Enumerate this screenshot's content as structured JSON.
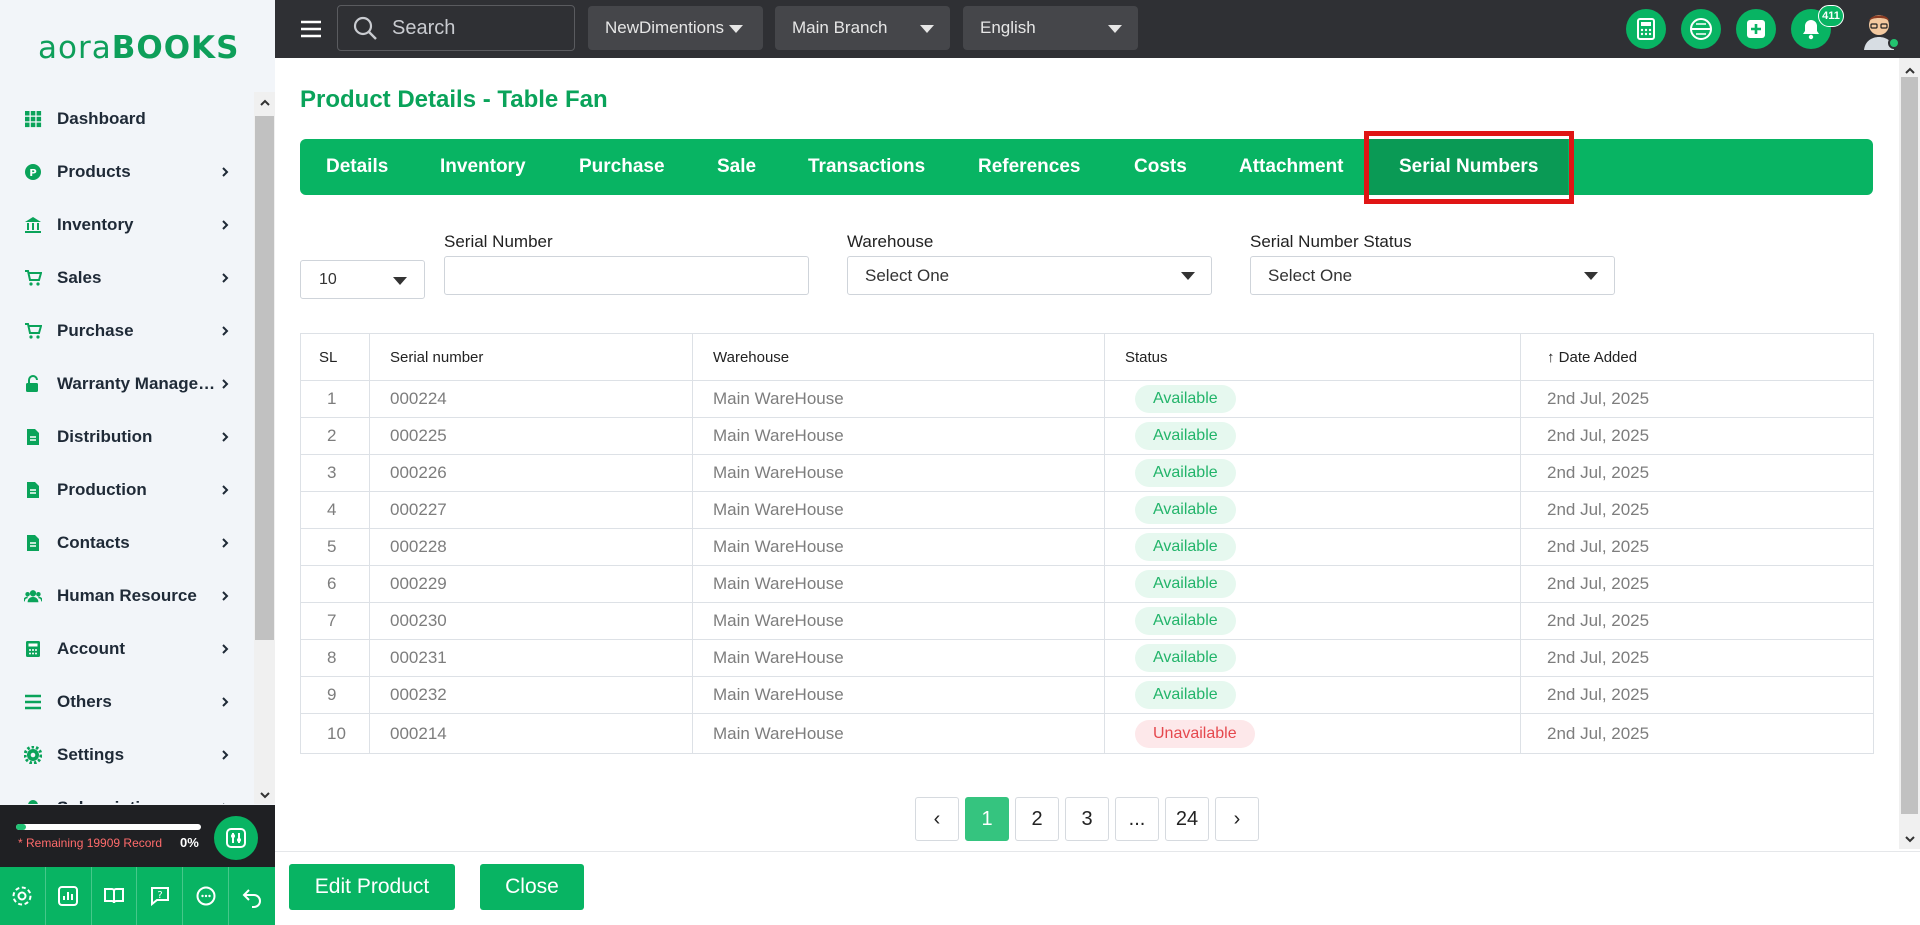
{
  "brand": {
    "logo_part1": "aora",
    "logo_part2": "BOOKS"
  },
  "sidebar": {
    "items": [
      {
        "label": "Dashboard",
        "icon": "grid-icon",
        "chevron": false
      },
      {
        "label": "Products",
        "icon": "product-icon",
        "chevron": true
      },
      {
        "label": "Inventory",
        "icon": "bank-icon",
        "chevron": true
      },
      {
        "label": "Sales",
        "icon": "cart-icon",
        "chevron": true
      },
      {
        "label": "Purchase",
        "icon": "cart-icon",
        "chevron": true
      },
      {
        "label": "Warranty Management",
        "icon": "lock-icon",
        "chevron": true
      },
      {
        "label": "Distribution",
        "icon": "file-icon",
        "chevron": true
      },
      {
        "label": "Production",
        "icon": "file-icon",
        "chevron": true
      },
      {
        "label": "Contacts",
        "icon": "file-icon",
        "chevron": true
      },
      {
        "label": "Human Resource",
        "icon": "users-icon",
        "chevron": true
      },
      {
        "label": "Account",
        "icon": "calculator-icon",
        "chevron": true
      },
      {
        "label": "Others",
        "icon": "list-icon",
        "chevron": true
      },
      {
        "label": "Settings",
        "icon": "gear-icon",
        "chevron": true
      },
      {
        "label": "Subscription",
        "icon": "bell-icon",
        "chevron": true
      }
    ],
    "quota": {
      "text": "* Remaining 19909 Record",
      "percent": "0%"
    }
  },
  "topbar": {
    "search_placeholder": "Search",
    "company": "NewDimentions",
    "branch": "Main Branch",
    "language": "English",
    "notification_count": "411"
  },
  "page": {
    "title": "Product Details - Table Fan",
    "tabs": [
      "Details",
      "Inventory",
      "Purchase",
      "Sale",
      "Transactions",
      "References",
      "Costs",
      "Attachment",
      "Serial Numbers"
    ],
    "active_tab": "Serial Numbers"
  },
  "filters": {
    "per_page": "10",
    "serial_label": "Serial Number",
    "serial_value": "",
    "warehouse_label": "Warehouse",
    "warehouse_value": "Select One",
    "status_label": "Serial Number Status",
    "status_value": "Select One"
  },
  "table": {
    "headers": [
      "SL",
      "Serial number",
      "Warehouse",
      "Status",
      "Date Added"
    ],
    "rows": [
      [
        "1",
        "000224",
        "Main WareHouse",
        "Available",
        "2nd Jul, 2025"
      ],
      [
        "2",
        "000225",
        "Main WareHouse",
        "Available",
        "2nd Jul, 2025"
      ],
      [
        "3",
        "000226",
        "Main WareHouse",
        "Available",
        "2nd Jul, 2025"
      ],
      [
        "4",
        "000227",
        "Main WareHouse",
        "Available",
        "2nd Jul, 2025"
      ],
      [
        "5",
        "000228",
        "Main WareHouse",
        "Available",
        "2nd Jul, 2025"
      ],
      [
        "6",
        "000229",
        "Main WareHouse",
        "Available",
        "2nd Jul, 2025"
      ],
      [
        "7",
        "000230",
        "Main WareHouse",
        "Available",
        "2nd Jul, 2025"
      ],
      [
        "8",
        "000231",
        "Main WareHouse",
        "Available",
        "2nd Jul, 2025"
      ],
      [
        "9",
        "000232",
        "Main WareHouse",
        "Available",
        "2nd Jul, 2025"
      ],
      [
        "10",
        "000214",
        "Main WareHouse",
        "Unavailable",
        "2nd Jul, 2025"
      ]
    ]
  },
  "pagination": {
    "prev": "‹",
    "pages": [
      "1",
      "2",
      "3",
      "...",
      "24"
    ],
    "next": "›",
    "current": "1"
  },
  "footer": {
    "edit_label": "Edit Product",
    "close_label": "Close"
  },
  "colors": {
    "brand_green": "#08b463",
    "topbar": "#2f3034",
    "available": "#22b46a",
    "unavailable": "#e5484d",
    "highlight": "#e01515"
  }
}
